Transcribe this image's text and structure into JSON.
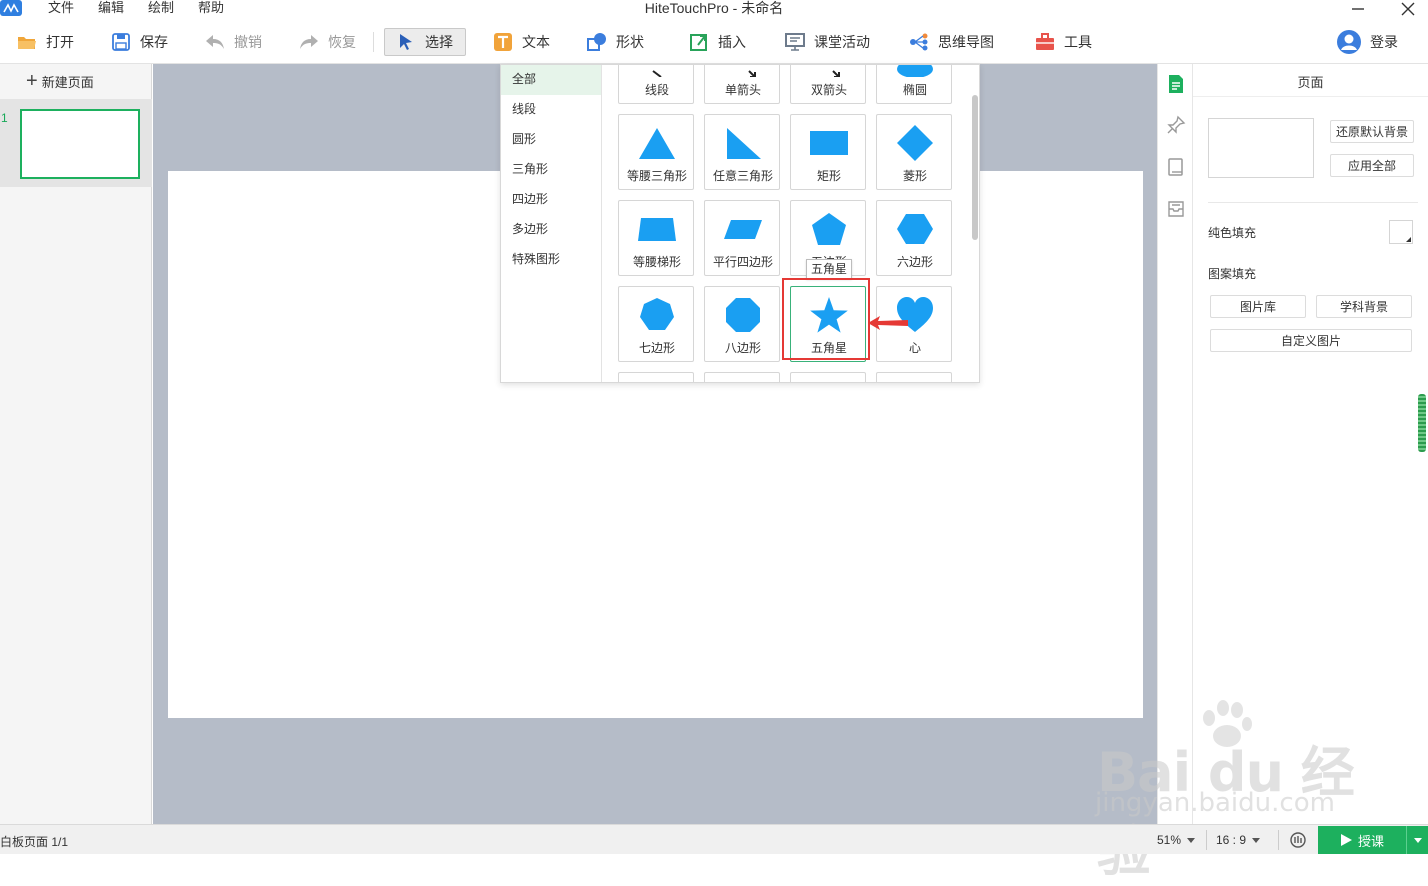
{
  "titlebar": {
    "title": "HiteTouchPro - 未命名",
    "menus": [
      "文件",
      "编辑",
      "绘制",
      "帮助"
    ]
  },
  "toolbar": {
    "open": "打开",
    "save": "保存",
    "undo": "撤销",
    "redo": "恢复",
    "select": "选择",
    "text": "文本",
    "shape": "形状",
    "insert": "插入",
    "activity": "课堂活动",
    "mindmap": "思维导图",
    "tools": "工具",
    "login": "登录"
  },
  "left_panel": {
    "new_page": "新建页面",
    "pages": [
      {
        "number": "1"
      }
    ]
  },
  "shape_panel": {
    "categories": [
      "全部",
      "线段",
      "圆形",
      "三角形",
      "四边形",
      "多边形",
      "特殊图形"
    ],
    "active_category": "全部",
    "shapes": [
      {
        "label": "线段",
        "icon": "line-segment-icon"
      },
      {
        "label": "单箭头",
        "icon": "single-arrow-icon"
      },
      {
        "label": "双箭头",
        "icon": "double-arrow-icon"
      },
      {
        "label": "椭圆",
        "icon": "ellipse-icon"
      },
      {
        "label": "等腰三角形",
        "icon": "isosceles-triangle-icon"
      },
      {
        "label": "任意三角形",
        "icon": "right-triangle-icon"
      },
      {
        "label": "矩形",
        "icon": "rectangle-icon"
      },
      {
        "label": "菱形",
        "icon": "diamond-icon"
      },
      {
        "label": "等腰梯形",
        "icon": "trapezoid-icon"
      },
      {
        "label": "平行四边形",
        "icon": "parallelogram-icon"
      },
      {
        "label": "五边形",
        "icon": "pentagon-icon"
      },
      {
        "label": "六边形",
        "icon": "hexagon-icon"
      },
      {
        "label": "七边形",
        "icon": "heptagon-icon"
      },
      {
        "label": "八边形",
        "icon": "octagon-icon"
      },
      {
        "label": "五角星",
        "icon": "star-icon"
      },
      {
        "label": "心",
        "icon": "heart-icon"
      }
    ],
    "tooltip": "五角星",
    "shape_color": "#1a9ff2"
  },
  "right_panel": {
    "title": "页面",
    "reset_bg": "还原默认背景",
    "apply_all": "应用全部",
    "solid_fill": "纯色填充",
    "pattern_fill": "图案填充",
    "gallery": "图片库",
    "subject_bg": "学科背景",
    "custom_image": "自定义图片"
  },
  "statusbar": {
    "page_info": "白板页面 1/1",
    "zoom": "51%",
    "ratio": "16 : 9",
    "start": "授课"
  },
  "watermark": {
    "main": "Bai du 经验",
    "sub": "jingyan.baidu.com"
  },
  "colors": {
    "accent": "#1db05e",
    "shape": "#1a9ff2",
    "annotation": "#e53935"
  }
}
